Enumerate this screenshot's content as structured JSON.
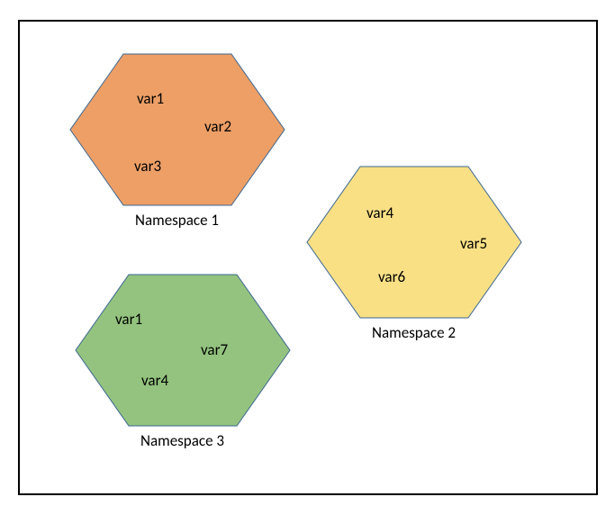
{
  "namespaces": [
    {
      "label": "Namespace 1",
      "fill": "#ED9F66",
      "stroke": "#3B6793",
      "vars": [
        "var1",
        "var2",
        "var3"
      ]
    },
    {
      "label": "Namespace 2",
      "fill": "#F9E085",
      "stroke": "#3B6793",
      "vars": [
        "var4",
        "var5",
        "var6"
      ]
    },
    {
      "label": "Namespace 3",
      "fill": "#93C37E",
      "stroke": "#3B6793",
      "vars": [
        "var1",
        "var7",
        "var4"
      ]
    }
  ]
}
